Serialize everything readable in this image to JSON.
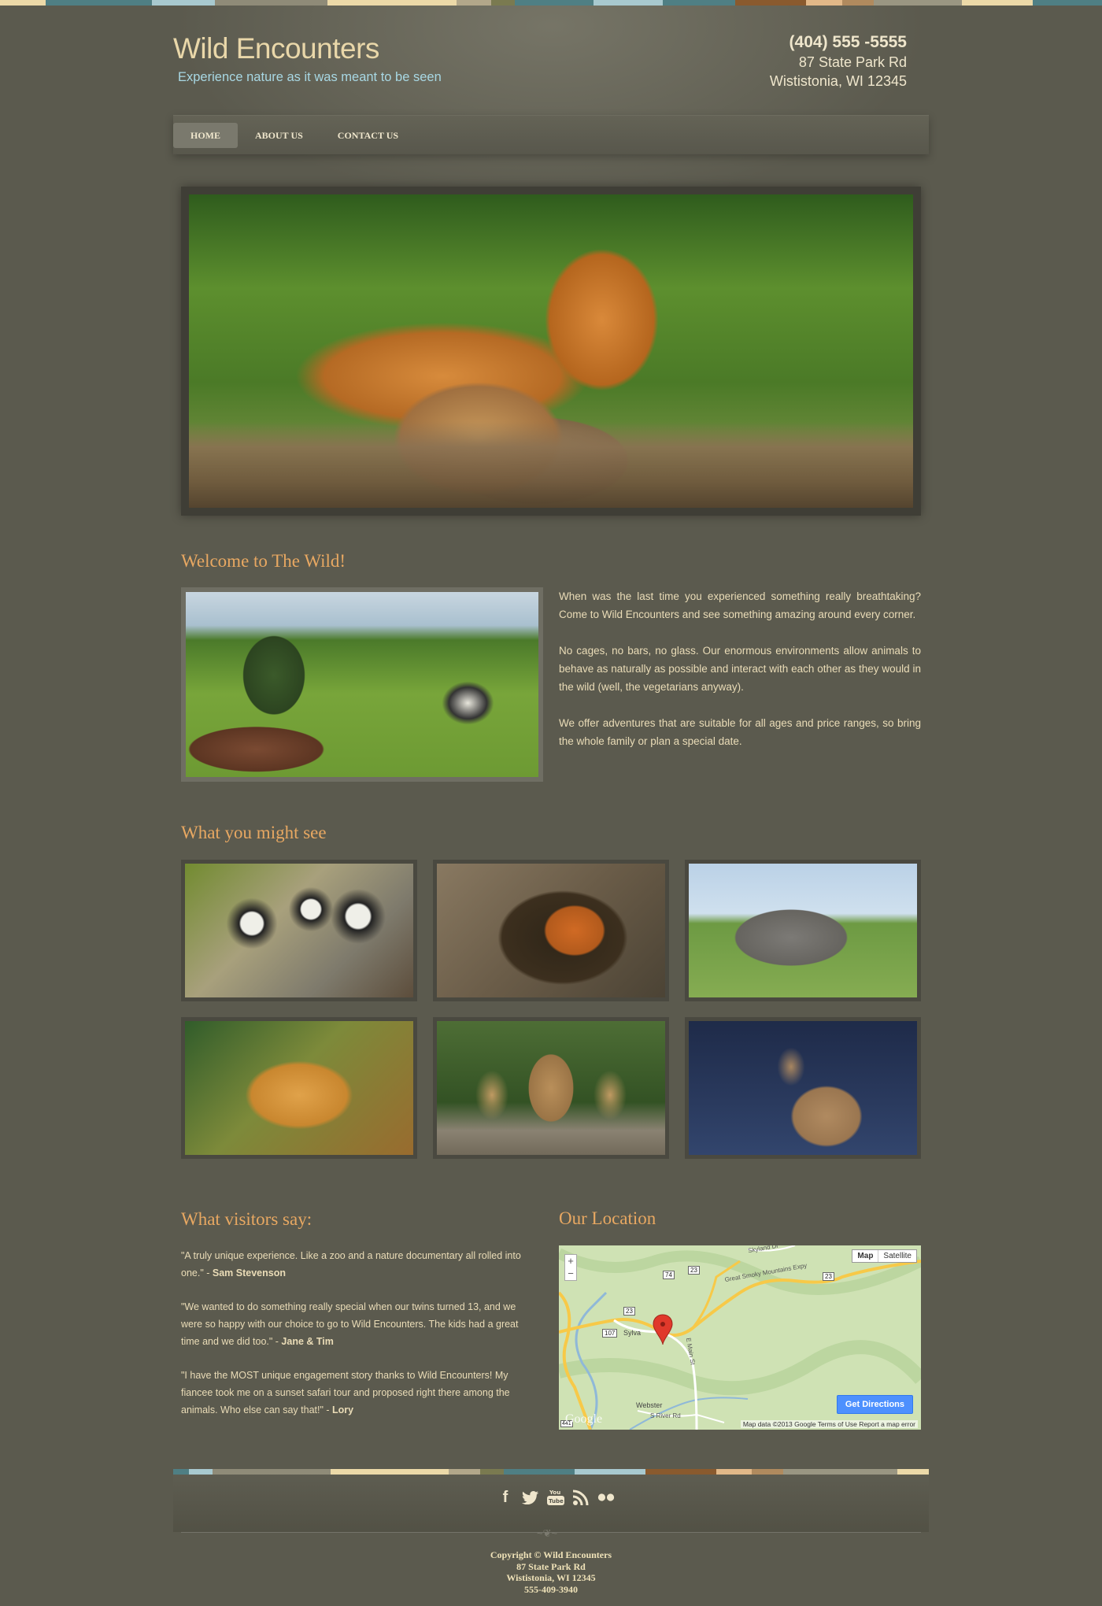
{
  "site": {
    "title": "Wild Encounters",
    "tagline": "Experience nature as it was meant to be seen",
    "phone": "(404) 555 -5555",
    "address_line1": "87 State Park Rd",
    "address_line2": "Wististonia, WI 12345"
  },
  "nav": {
    "items": [
      {
        "label": "HOME"
      },
      {
        "label": "ABOUT US"
      },
      {
        "label": "CONTACT US"
      }
    ]
  },
  "welcome": {
    "heading": "Welcome to The Wild!",
    "paragraphs": [
      "When was the last time you experienced something really breathtaking? Come to Wild Encounters and see something amazing around every corner.",
      "No cages, no bars, no glass. Our enormous environments allow animals to behave as naturally as possible and interact with each other as they would in the wild (well, the vegetarians anyway).",
      "We offer adventures that are suitable for all ages and price ranges, so bring the whole family or plan a special date."
    ]
  },
  "gallery": {
    "heading": "What you might see"
  },
  "testimonials": {
    "heading": "What visitors say:",
    "items": [
      {
        "quote": "\"A truly unique experience. Like a zoo and a nature documentary all rolled into one.\" - ",
        "author": "Sam Stevenson"
      },
      {
        "quote": "\"We wanted to do something really special when our twins turned 13, and we were so happy with our choice to go to Wild Encounters. The kids had a great time and we did too.\" - ",
        "author": "Jane & Tim"
      },
      {
        "quote": "\"I have the MOST unique engagement story thanks to Wild Encounters! My fiancee took me on a sunset safari tour and proposed right there among the animals. Who else can say that!\" - ",
        "author": "Lory"
      }
    ]
  },
  "location": {
    "heading": "Our Location",
    "map_type_map": "Map",
    "map_type_satellite": "Satellite",
    "zoom_in": "+",
    "zoom_out": "−",
    "get_directions": "Get Directions",
    "credit": "Map data ©2013 Google   Terms of Use   Report a map error",
    "google": "Google",
    "labels": {
      "sylva": "Sylva",
      "webster": "Webster",
      "skyland": "Skyland Dr",
      "smoky": "Great Smoky Mountains Expy",
      "main_st": "E Main St",
      "river_rd": "S River Rd",
      "r74": "74",
      "r23a": "23",
      "r23b": "23",
      "r23c": "23",
      "r107": "107",
      "r441": "441"
    }
  },
  "footer": {
    "copyright": "Copyright © Wild Encounters",
    "address_line1": "87 State Park Rd",
    "address_line2": "Wististonia, WI 12345",
    "phone": "555-409-3940",
    "social": [
      "facebook-icon",
      "twitter-icon",
      "youtube-icon",
      "rss-icon",
      "flickr-icon"
    ]
  },
  "colors": {
    "background": "#5b5a4e",
    "heading_accent": "#e8a862",
    "tagline": "#a8d8e4",
    "text": "#eadcb7"
  }
}
